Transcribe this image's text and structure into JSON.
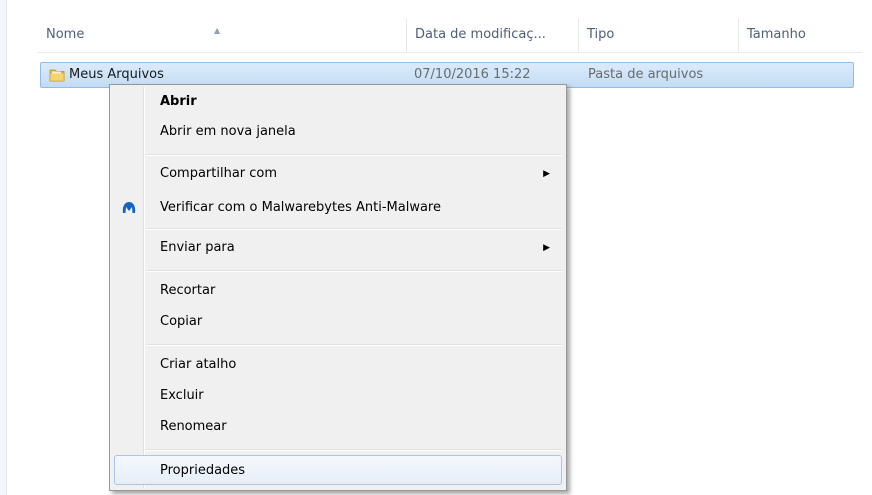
{
  "header": {
    "columns": [
      "Nome",
      "Data de modificaç...",
      "Tipo",
      "Tamanho"
    ]
  },
  "file_row": {
    "name": "Meus Arquivos",
    "date": "07/10/2016 15:22",
    "type": "Pasta de arquivos"
  },
  "context_menu": {
    "items": [
      {
        "label": "Abrir"
      },
      {
        "label": "Abrir em nova janela"
      },
      {
        "label": "Compartilhar com",
        "submenu": true
      },
      {
        "label": "Verificar com o Malwarebytes Anti-Malware",
        "icon": "malwarebytes-icon"
      },
      {
        "label": "Enviar para",
        "submenu": true
      },
      {
        "label": "Recortar"
      },
      {
        "label": "Copiar"
      },
      {
        "label": "Criar atalho"
      },
      {
        "label": "Excluir"
      },
      {
        "label": "Renomear"
      },
      {
        "label": "Propriedades"
      }
    ],
    "submenu_arrow": "▶"
  },
  "colors": {
    "selection": "#cce4f9",
    "menu_background": "#f0f0f0",
    "malwarebytes_blue": "#1565c0"
  }
}
